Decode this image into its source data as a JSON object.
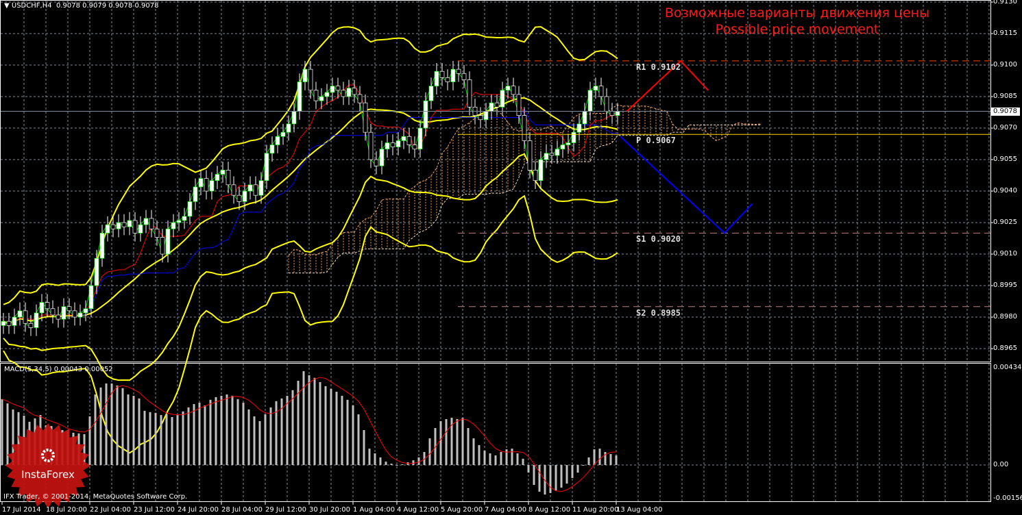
{
  "header": {
    "symbol": "USDCHF,H4",
    "ohlc": "0.9078 0.9079 0.9078 0.9078"
  },
  "annotation": {
    "line1": "Возможные варианты движения цены",
    "line2": "Possible price movement"
  },
  "macd_header": {
    "label": "MACD(5,34,5)",
    "values": "0.00043 0.00052"
  },
  "copyright": "IFX Trader, © 2001-2014, MetaQuotes Software Corp.",
  "logo": {
    "text": "InstaForex"
  },
  "current_price": "0.9078",
  "colors": {
    "background": "#000000",
    "grid": "#7f8c99",
    "bull": "#ffffff",
    "bear": "#000000",
    "bands": "#ffff00",
    "tenkan": "#ff0000",
    "kijun": "#0000ff",
    "chikou": "#00cc00",
    "cloud": "#f4a460",
    "pivot": "#ffd700",
    "r1": "#ff4500",
    "support": "#c08080",
    "forecast_up": "#ff0000",
    "forecast_down": "#0000ff",
    "macd_hist": "#c0c0c0",
    "macd_signal": "#ff0000",
    "annotation": "#ff1a1a"
  },
  "chart_data": [
    {
      "type": "candlestick",
      "symbol": "USDCHF",
      "timeframe": "H4",
      "ylim": [
        0.8958,
        0.9133
      ],
      "y_ticks": [
        "0.9130",
        "0.9115",
        "0.9100",
        "0.9085",
        "0.9070",
        "0.9055",
        "0.9040",
        "0.9025",
        "0.9010",
        "0.8995",
        "0.8980",
        "0.8965"
      ],
      "x_tick_labels": [
        "17 Jul 2014",
        "18 Jul 20:00",
        "22 Jul 04:00",
        "23 Jul 12:00",
        "24 Jul 20:00",
        "28 Jul 04:00",
        "29 Jul 12:00",
        "30 Jul 20:00",
        "1 Aug 04:00",
        "4 Aug 12:00",
        "5 Aug 20:00",
        "7 Aug 04:00",
        "8 Aug 12:00",
        "11 Aug 20:00",
        "13 Aug 04:00"
      ],
      "closes": [
        0.8978,
        0.8976,
        0.898,
        0.8983,
        0.8977,
        0.8975,
        0.8982,
        0.8987,
        0.8984,
        0.8981,
        0.8979,
        0.8985,
        0.8983,
        0.898,
        0.8982,
        0.8984,
        0.8995,
        0.9008,
        0.902,
        0.9024,
        0.9022,
        0.9025,
        0.9023,
        0.9026,
        0.902,
        0.9024,
        0.9027,
        0.9022,
        0.9018,
        0.901,
        0.9022,
        0.9025,
        0.9026,
        0.9028,
        0.9035,
        0.9042,
        0.9046,
        0.904,
        0.9045,
        0.9048,
        0.905,
        0.9043,
        0.9038,
        0.9035,
        0.904,
        0.9043,
        0.9038,
        0.9045,
        0.9058,
        0.9062,
        0.9066,
        0.9068,
        0.9072,
        0.9078,
        0.9092,
        0.9098,
        0.9088,
        0.9083,
        0.9085,
        0.9087,
        0.909,
        0.9088,
        0.9085,
        0.9089,
        0.9086,
        0.9082,
        0.9068,
        0.9055,
        0.9052,
        0.906,
        0.9063,
        0.9061,
        0.9064,
        0.9066,
        0.9062,
        0.906,
        0.907,
        0.9083,
        0.909,
        0.9097,
        0.9094,
        0.9092,
        0.9098,
        0.9096,
        0.9093,
        0.908,
        0.9076,
        0.9074,
        0.9078,
        0.9082,
        0.908,
        0.9088,
        0.909,
        0.9086,
        0.9076,
        0.9064,
        0.905,
        0.9045,
        0.9055,
        0.9058,
        0.9057,
        0.906,
        0.9062,
        0.9063,
        0.9068,
        0.9072,
        0.9078,
        0.9088,
        0.909,
        0.9085,
        0.9078,
        0.9076,
        0.9078
      ],
      "levels": [
        {
          "name": "R1",
          "label": "R1  0.9102",
          "value": 0.9102,
          "style": "dashed"
        },
        {
          "name": "P",
          "label": "P  0.9067",
          "value": 0.9067,
          "style": "solid"
        },
        {
          "name": "S1",
          "label": "S1  0.9020",
          "value": 0.902,
          "style": "dashed"
        },
        {
          "name": "S2",
          "label": "S2  0.8985",
          "value": 0.8985,
          "style": "dashed"
        }
      ],
      "forecast_up": [
        [
          113.7,
          0.9078
        ],
        [
          123.5,
          0.9102
        ],
        [
          128.5,
          0.9088
        ]
      ],
      "forecast_down": [
        [
          112.5,
          0.9066
        ],
        [
          131.5,
          0.902
        ],
        [
          136.6,
          0.9034
        ]
      ]
    },
    {
      "type": "bar",
      "name": "MACD(5,34,5)",
      "ylim": [
        -0.00156,
        0.00434
      ],
      "y_ticks": [
        "0.00434",
        "0.00",
        "-0.00156"
      ],
      "histogram": [
        0.00294,
        0.00275,
        0.00248,
        0.00236,
        0.0022,
        0.00193,
        0.00208,
        0.00223,
        0.00177,
        0.00174,
        0.0015,
        0.00156,
        0.00156,
        0.00144,
        0.00141,
        0.00138,
        0.00217,
        0.00315,
        0.00346,
        0.00364,
        0.00364,
        0.00355,
        0.00343,
        0.00315,
        0.00309,
        0.00297,
        0.00242,
        0.00236,
        0.00233,
        0.00223,
        0.00226,
        0.00214,
        0.00223,
        0.00239,
        0.00257,
        0.00272,
        0.00278,
        0.00266,
        0.00291,
        0.00303,
        0.00309,
        0.00315,
        0.00309,
        0.00294,
        0.00278,
        0.00248,
        0.00217,
        0.00196,
        0.00226,
        0.00257,
        0.00285,
        0.00297,
        0.00309,
        0.00334,
        0.00376,
        0.00419,
        0.00401,
        0.00389,
        0.0037,
        0.00352,
        0.0034,
        0.00327,
        0.00309,
        0.00291,
        0.00266,
        0.00226,
        0.00156,
        0.00073,
        0.00052,
        0.00034,
        0.00015,
        6e-05,
        -3e-05,
        3e-05,
        0.00012,
        0.00021,
        0.00034,
        0.00058,
        0.00119,
        0.00165,
        0.00196,
        0.00205,
        0.00211,
        0.00205,
        0.00211,
        0.00165,
        0.00119,
        0.00089,
        0.00064,
        0.00052,
        0.00043,
        0.00058,
        0.0007,
        0.00073,
        0.00052,
        0.00028,
        -0.00034,
        -0.00089,
        -0.00119,
        -0.00132,
        -0.00125,
        -0.00113,
        -0.00101,
        -0.00083,
        -0.00058,
        -0.00034,
        -3e-05,
        0.00034,
        0.0007,
        0.00073,
        0.00058,
        0.00049,
        0.00043
      ]
    }
  ]
}
